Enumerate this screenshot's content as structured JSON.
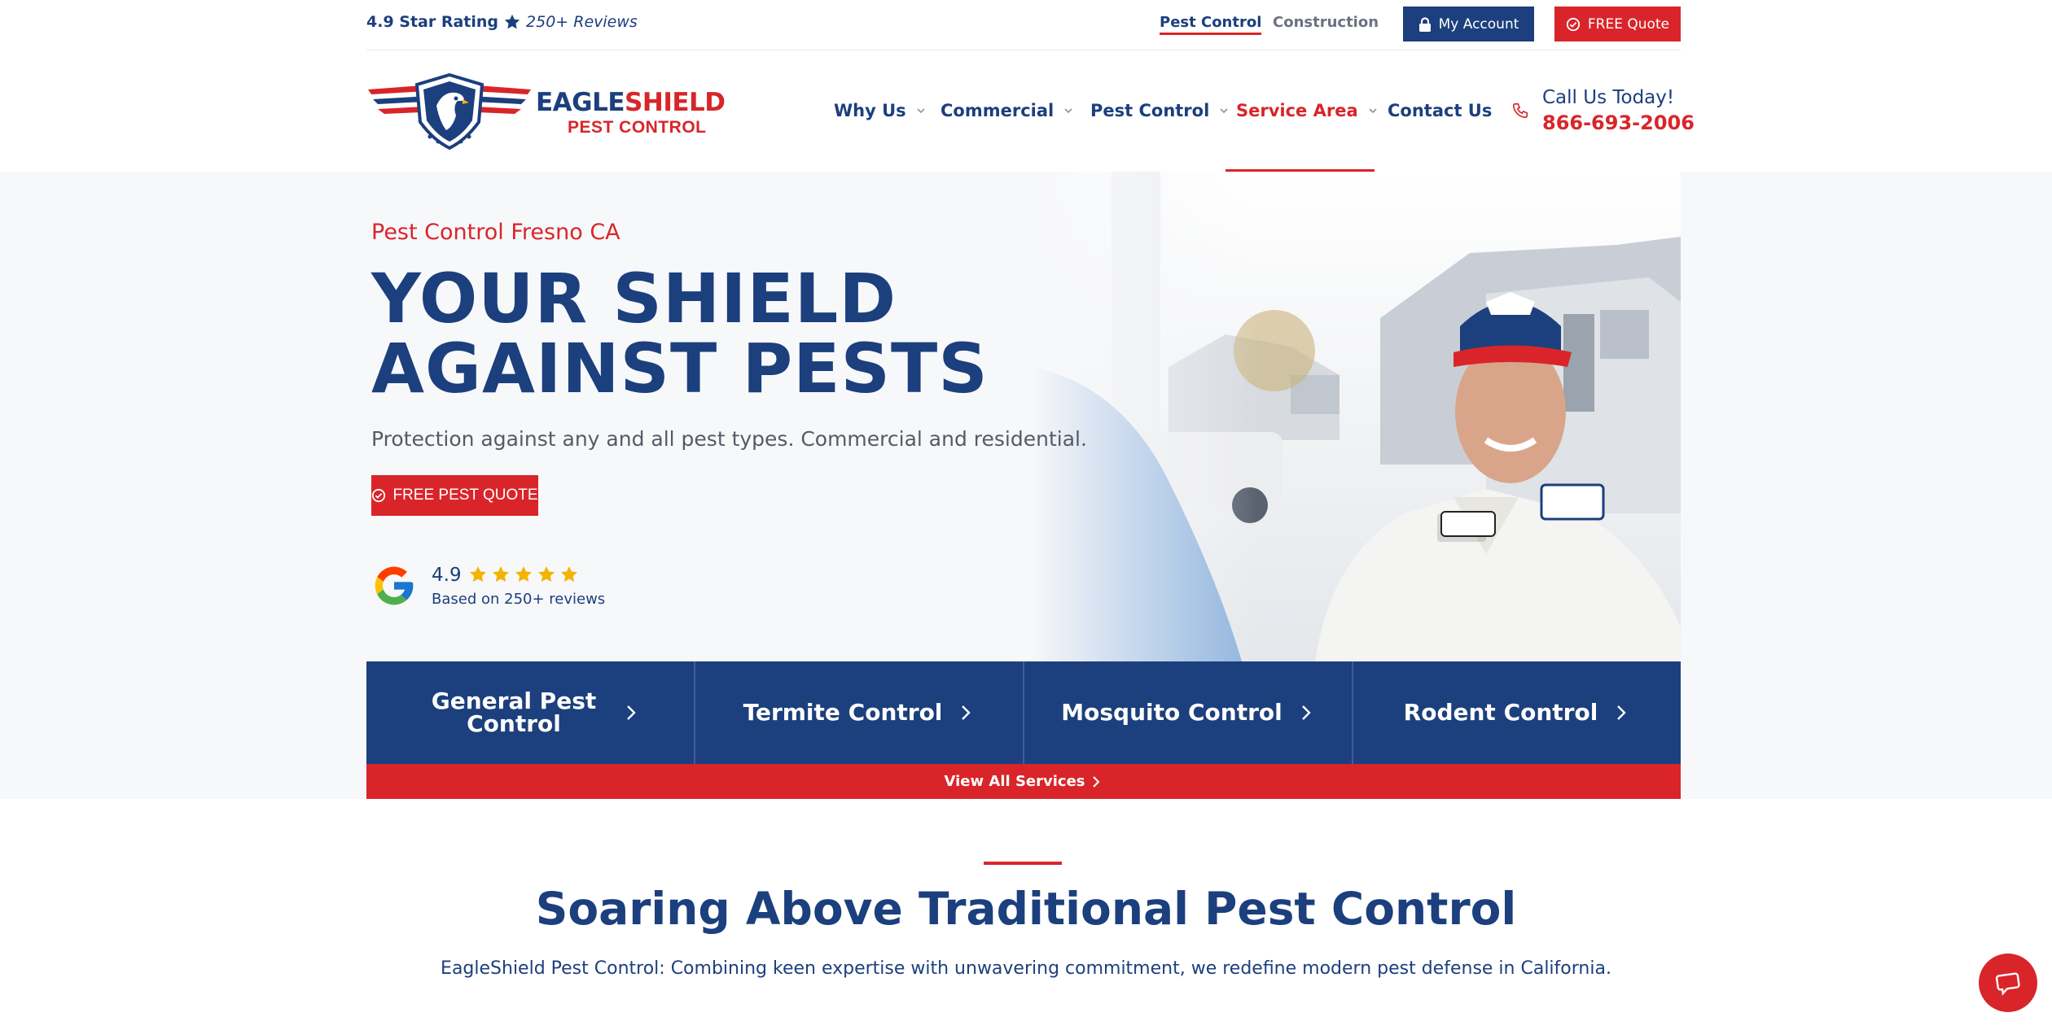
{
  "topbar": {
    "rating_value": "4.9 Star Rating",
    "reviews": "250+ Reviews",
    "links": {
      "pest_control": "Pest Control",
      "construction": "Construction"
    },
    "my_account": "My Account",
    "free_quote": "FREE Quote"
  },
  "brand": {
    "name_a": "EAGLE",
    "name_b": "SHIELD",
    "sub": "PEST CONTROL"
  },
  "nav": {
    "why_us": "Why Us",
    "commercial": "Commercial",
    "pest_control": "Pest Control",
    "service_area": "Service Area",
    "contact_us": "Contact Us"
  },
  "call": {
    "label": "Call Us Today!",
    "number": "866-693-2006"
  },
  "hero": {
    "kicker": "Pest Control Fresno CA",
    "title_line1": "YOUR SHIELD",
    "title_line2": "AGAINST PESTS",
    "subtitle": "Protection against any and all pest types. Commercial and residential.",
    "cta": "FREE PEST QUOTE"
  },
  "google_rating": {
    "score": "4.9",
    "stars": 5,
    "based_on": "Based on 250+ reviews"
  },
  "services": {
    "general": "General Pest Control",
    "termite": "Termite Control",
    "mosquito": "Mosquito Control",
    "rodent": "Rodent Control",
    "view_all": "View All Services"
  },
  "section": {
    "title": "Soaring Above Traditional Pest Control",
    "subtitle": "EagleShield Pest Control: Combining keen expertise with unwavering commitment, we redefine modern pest defense in California."
  },
  "colors": {
    "navy": "#1c3f7d",
    "red": "#d9252a",
    "star": "#f5b301"
  },
  "icons": [
    "star-icon",
    "lock-icon",
    "check-circle-icon",
    "chevron-down-icon",
    "phone-icon",
    "google-icon",
    "chevron-right-icon",
    "chat-icon"
  ]
}
